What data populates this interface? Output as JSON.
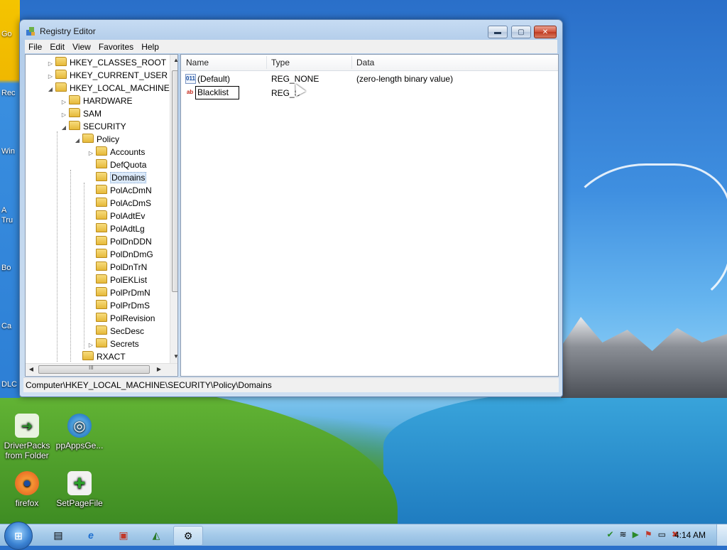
{
  "desktop": {
    "left_labels": [
      "Go",
      "Rec",
      "Win",
      "A",
      "Tru",
      "Bo",
      "Ca",
      "DLC"
    ],
    "icons": [
      {
        "label": "DriverPacks from Folder",
        "icon": "driverpacks-icon"
      },
      {
        "label": "ppAppsGe...",
        "icon": "ppapps-icon"
      },
      {
        "label": "firefox",
        "icon": "firefox-icon"
      },
      {
        "label": "SetPageFile",
        "icon": "setpagefile-icon"
      }
    ]
  },
  "window": {
    "title": "Registry Editor",
    "menu": [
      "File",
      "Edit",
      "View",
      "Favorites",
      "Help"
    ],
    "controls": {
      "min": "▬",
      "max": "▢",
      "close": "✕"
    },
    "tree": [
      {
        "label": "HKEY_CLASSES_ROOT",
        "level": 0,
        "expander": "▷"
      },
      {
        "label": "HKEY_CURRENT_USER",
        "level": 0,
        "expander": "▷"
      },
      {
        "label": "HKEY_LOCAL_MACHINE",
        "level": 0,
        "expander": "◢"
      },
      {
        "label": "HARDWARE",
        "level": 1,
        "expander": "▷"
      },
      {
        "label": "SAM",
        "level": 1,
        "expander": "▷"
      },
      {
        "label": "SECURITY",
        "level": 1,
        "expander": "◢"
      },
      {
        "label": "Policy",
        "level": 2,
        "expander": "◢"
      },
      {
        "label": "Accounts",
        "level": 3,
        "expander": "▷"
      },
      {
        "label": "DefQuota",
        "level": 3,
        "expander": ""
      },
      {
        "label": "Domains",
        "level": 3,
        "expander": "",
        "selected": true
      },
      {
        "label": "PolAcDmN",
        "level": 3,
        "expander": ""
      },
      {
        "label": "PolAcDmS",
        "level": 3,
        "expander": ""
      },
      {
        "label": "PolAdtEv",
        "level": 3,
        "expander": ""
      },
      {
        "label": "PolAdtLg",
        "level": 3,
        "expander": ""
      },
      {
        "label": "PolDnDDN",
        "level": 3,
        "expander": ""
      },
      {
        "label": "PolDnDmG",
        "level": 3,
        "expander": ""
      },
      {
        "label": "PolDnTrN",
        "level": 3,
        "expander": ""
      },
      {
        "label": "PolEKList",
        "level": 3,
        "expander": ""
      },
      {
        "label": "PolPrDmN",
        "level": 3,
        "expander": ""
      },
      {
        "label": "PolPrDmS",
        "level": 3,
        "expander": ""
      },
      {
        "label": "PolRevision",
        "level": 3,
        "expander": ""
      },
      {
        "label": "SecDesc",
        "level": 3,
        "expander": ""
      },
      {
        "label": "Secrets",
        "level": 3,
        "expander": "▷"
      },
      {
        "label": "RXACT",
        "level": 2,
        "expander": ""
      }
    ],
    "columns": {
      "name": "Name",
      "type": "Type",
      "data": "Data"
    },
    "values": [
      {
        "icon": "binary-value-icon",
        "icon_text": "011",
        "name": "(Default)",
        "type": "REG_NONE",
        "data": "(zero-length binary value)"
      },
      {
        "icon": "string-value-icon",
        "icon_text": "ab",
        "name": "Blacklist",
        "type": "REG_S",
        "data": "",
        "editing": true
      }
    ],
    "status": "Computer\\HKEY_LOCAL_MACHINE\\SECURITY\\Policy\\Domains",
    "hscroll_thumb": "III"
  },
  "taskbar": {
    "start_label": "⊞",
    "buttons": [
      {
        "icon": "explorer-icon",
        "glyph": "▤"
      },
      {
        "icon": "ie-icon",
        "glyph": "e"
      },
      {
        "icon": "media-icon",
        "glyph": "▣"
      },
      {
        "icon": "pinned-app-icon",
        "glyph": "◭"
      },
      {
        "icon": "regedit-icon",
        "glyph": "⚙",
        "active": true
      }
    ],
    "tray": [
      "✔",
      "≋",
      "▶",
      "⚑",
      "▭",
      "✖"
    ],
    "clock": "4:14 AM"
  },
  "colors": {
    "selection": "#dbe9f9",
    "titlebar": "#c7dcf3"
  }
}
